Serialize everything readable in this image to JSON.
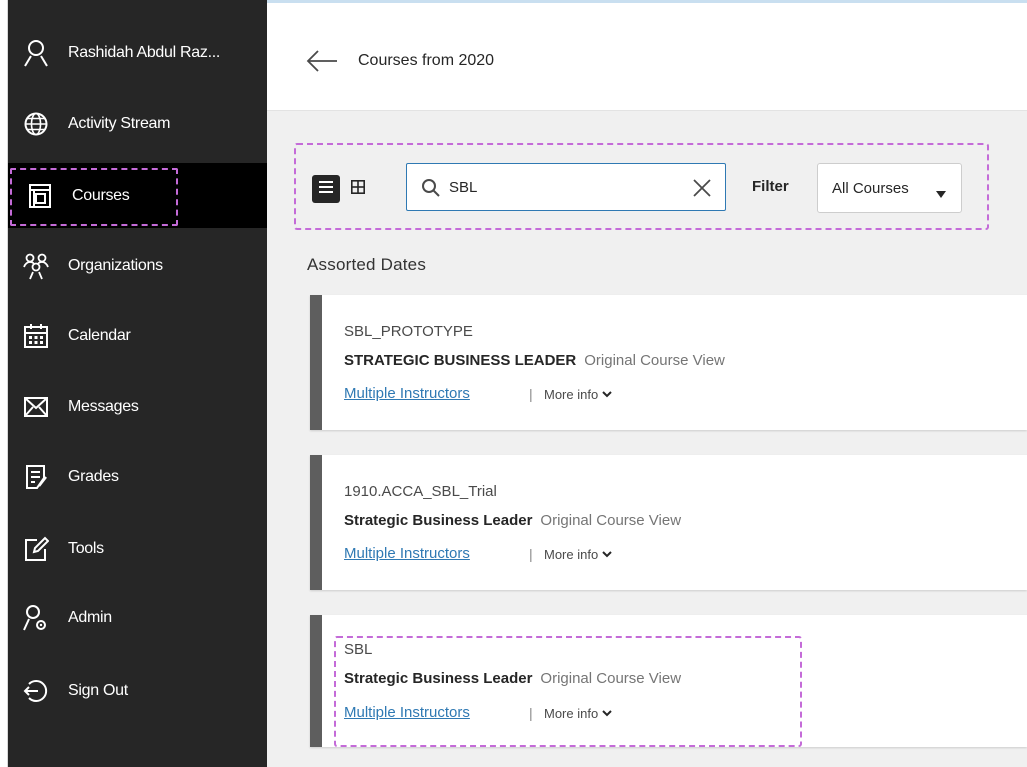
{
  "sidebar": {
    "items": [
      {
        "label": "Rashidah Abdul Raz...",
        "icon": "user-icon"
      },
      {
        "label": "Activity Stream",
        "icon": "globe-icon"
      },
      {
        "label": "Courses",
        "icon": "courses-icon",
        "active": true
      },
      {
        "label": "Organizations",
        "icon": "organizations-icon"
      },
      {
        "label": "Calendar",
        "icon": "calendar-icon"
      },
      {
        "label": "Messages",
        "icon": "envelope-icon"
      },
      {
        "label": "Grades",
        "icon": "grades-icon"
      },
      {
        "label": "Tools",
        "icon": "tools-icon"
      },
      {
        "label": "Admin",
        "icon": "admin-icon"
      },
      {
        "label": "Sign Out",
        "icon": "sign-out-icon"
      }
    ]
  },
  "header": {
    "title": "Courses from 2020"
  },
  "toolbar": {
    "search_value": "SBL",
    "filter_label": "Filter",
    "filter_value": "All Courses"
  },
  "main": {
    "group_heading": "Assorted Dates",
    "courses": [
      {
        "id": "SBL_PROTOTYPE",
        "name": "STRATEGIC BUSINESS LEADER",
        "view": "Original Course View",
        "instructors": "Multiple Instructors",
        "separator": "|",
        "more": "More info"
      },
      {
        "id": "1910.ACCA_SBL_Trial",
        "name": "Strategic Business Leader",
        "view": "Original Course View",
        "instructors": "Multiple Instructors",
        "separator": "|",
        "more": "More info"
      },
      {
        "id": "SBL",
        "name": "Strategic Business Leader",
        "view": "Original Course View",
        "instructors": "Multiple Instructors",
        "separator": "|",
        "more": "More info"
      }
    ]
  },
  "colors": {
    "sidebar_bg": "#262626",
    "active_bg": "#000000",
    "link": "#2f79b3",
    "highlight": "#c46bd8",
    "card_accent": "#5e5e5e"
  }
}
